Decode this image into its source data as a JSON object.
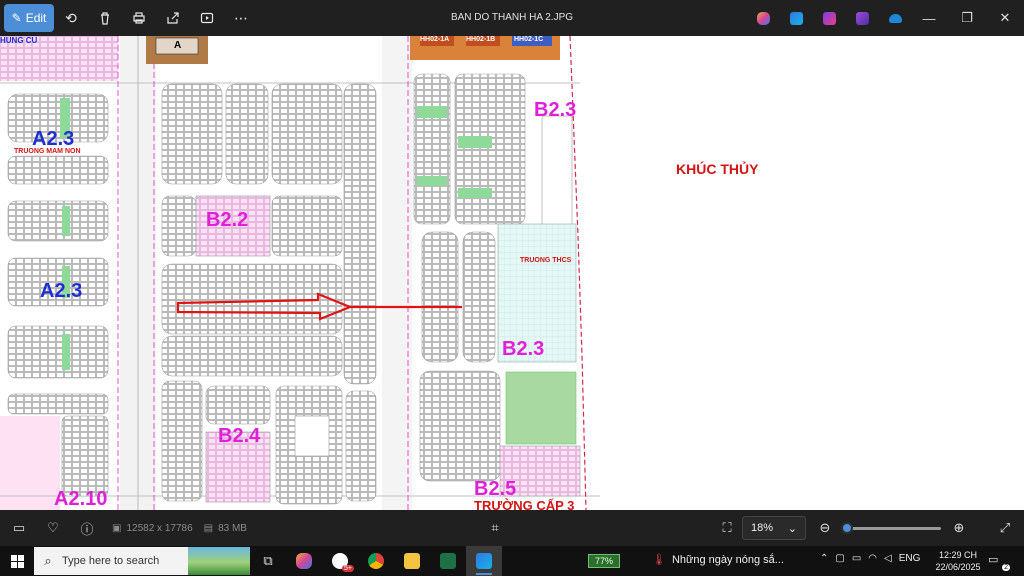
{
  "window": {
    "title": "BAN DO THANH HA 2.JPG",
    "edit_label": "Edit"
  },
  "toolbar": {
    "icons": [
      "rotate-icon",
      "delete-icon",
      "print-icon",
      "share-icon",
      "slideshow-icon",
      "more-icon"
    ],
    "more_glyph": "⋯"
  },
  "map_labels": {
    "zones": [
      {
        "text": "A2.3",
        "color": "blue"
      },
      {
        "text": "A2.3",
        "color": "blue"
      },
      {
        "text": "A2.10",
        "color": "magenta"
      },
      {
        "text": "B2.2",
        "color": "magenta"
      },
      {
        "text": "B2.3",
        "color": "magenta"
      },
      {
        "text": "B2.3",
        "color": "magenta"
      },
      {
        "text": "B2.4",
        "color": "magenta"
      },
      {
        "text": "B2.5",
        "color": "magenta"
      }
    ],
    "khuc_thuy": "KHÚC THỦY",
    "truong_mam_non": "TRUONG MAM NON",
    "truong_thcs": "TRUONG THCS",
    "truong_cap3": "TRƯỜNG CẤP 3",
    "nhung_cu": "HUNG CU",
    "hh_blocks": [
      "HH02-1A",
      "HH02-1B",
      "HH02-1C"
    ],
    "block_a": "A"
  },
  "bottombar": {
    "dimensions": "12582 x 17786",
    "file_size": "83 MB",
    "zoom": "18%",
    "zoom_level": 0.0
  },
  "taskbar": {
    "search_placeholder": "Type here to search",
    "chrome_badge": "5+",
    "battery": "77%",
    "weather": "Những ngày nóng sắ...",
    "lang": "ENG",
    "time": "12:29 CH",
    "date": "22/06/2025",
    "notif_count": "2"
  },
  "colors": {
    "accent": "#4c8fd6",
    "zone_magenta": "#e01fd8",
    "zone_blue": "#1e2fd0",
    "label_red": "#d31414"
  }
}
